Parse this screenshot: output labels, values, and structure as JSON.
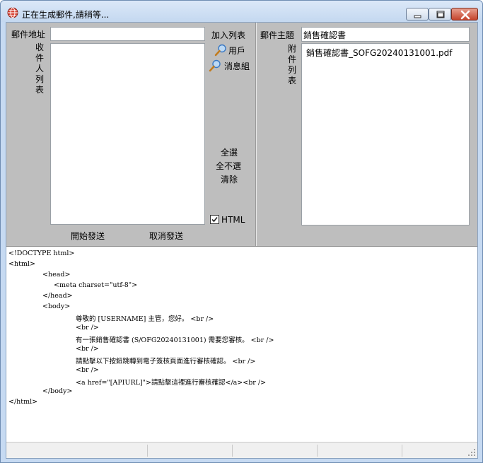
{
  "window": {
    "title": "正在生成郵件,請稍等..."
  },
  "left": {
    "mail_address_label": "郵件地址",
    "mail_address_value": "",
    "recipients_label": "收件人列表",
    "add_list_label": "加入列表",
    "user_link": "用戶",
    "group_link": "消息組",
    "select_all": "全選",
    "select_none": "全不選",
    "clear": "清除",
    "html_checkbox_label": "HTML",
    "html_checked": true,
    "start_send": "開始發送",
    "cancel_send": "取消發送"
  },
  "right": {
    "subject_label": "郵件主題",
    "subject_value": "銷售確認書",
    "attachments_label": "附件列表",
    "attachments": [
      "銷售確認書_SOFG20240131001.pdf"
    ]
  },
  "editor": {
    "lines": [
      "<!DOCTYPE html>",
      "<html>",
      "<head>",
      "<meta charset=\"utf-8\">",
      "</head>",
      "<body>",
      "尊敬的 [USERNAME] 主管，您好。 <br />",
      "<br />",
      "有一張銷售確認書 (S/OFG20240131001) 需要您審核。 <br />",
      "<br />",
      "請點擊以下按鈕跳轉到電子簽核頁面進行審核確認。 <br />",
      "<br />",
      "<a href=\"[APIURL]\">請點擊這裡進行審核確認</a><br />",
      "</body>",
      "</html>"
    ]
  },
  "icons": {
    "app": "globe-icon",
    "search": "magnifier-icon"
  }
}
